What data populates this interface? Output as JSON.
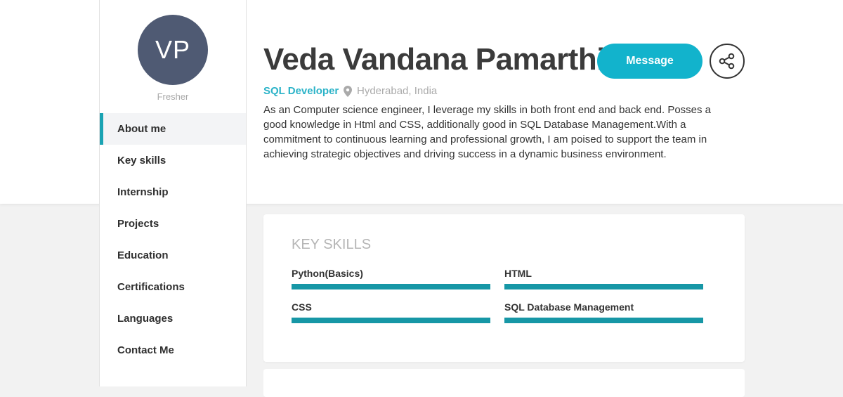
{
  "profile": {
    "initials": "VP",
    "status": "Fresher",
    "name": "Veda Vandana Pamarthi",
    "role": "SQL Developer",
    "location": "Hyderabad, India",
    "about": "As an Computer science engineer, I leverage my skills in both front end and back end. Posses a good knowledge in Html and CSS, additionally good in SQL Database Management.With a commitment to continuous learning and professional growth, I am poised to support the team in achieving strategic objectives and driving success in a dynamic business environment."
  },
  "actions": {
    "message_label": "Message",
    "share_icon": "share-icon"
  },
  "colors": {
    "accent": "#12b3cc",
    "bar": "#1797a6",
    "avatar": "#4f5a73"
  },
  "nav": {
    "items": [
      {
        "label": "About me",
        "active": true
      },
      {
        "label": "Key skills"
      },
      {
        "label": "Internship"
      },
      {
        "label": "Projects"
      },
      {
        "label": "Education"
      },
      {
        "label": "Certifications"
      },
      {
        "label": "Languages"
      },
      {
        "label": "Contact Me"
      }
    ]
  },
  "skills": {
    "title": "KEY SKILLS",
    "items": [
      {
        "label": "Python(Basics)",
        "level": 1.0
      },
      {
        "label": "HTML",
        "level": 1.0
      },
      {
        "label": "CSS",
        "level": 1.0
      },
      {
        "label": "SQL Database Management",
        "level": 1.0
      }
    ]
  }
}
